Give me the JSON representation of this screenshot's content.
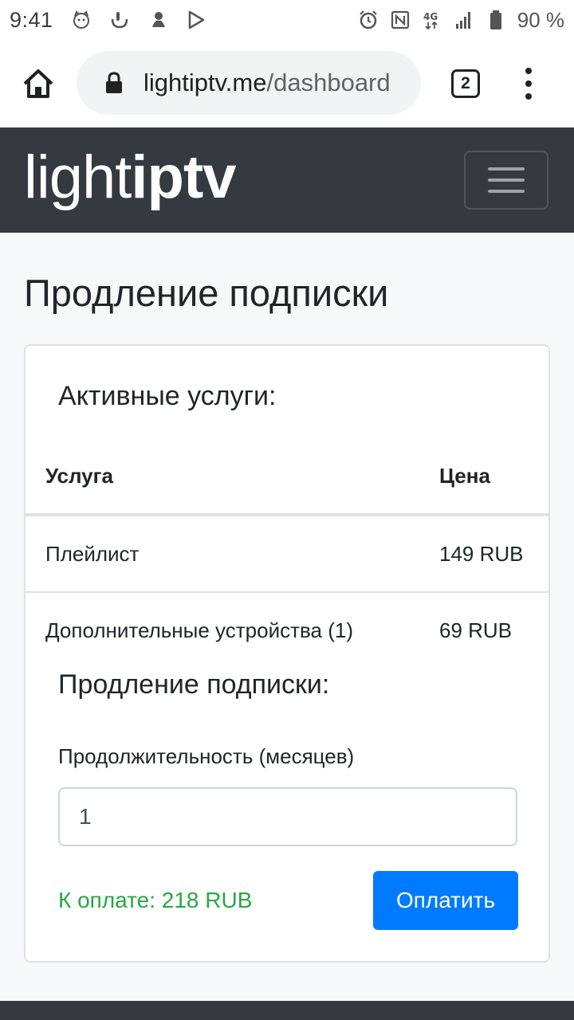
{
  "status_bar": {
    "time": "9:41",
    "battery_percent": "90 %",
    "left_icons": [
      "cat-notification-icon",
      "hand-notification-icon",
      "octopus-notification-icon",
      "play-store-icon"
    ],
    "right_icons": [
      "alarm-icon",
      "nfc-icon",
      "4g-signal-icon",
      "cell-signal-icon",
      "battery-icon"
    ]
  },
  "browser": {
    "url_host": "lightiptv.me",
    "url_path": "/dashboard",
    "tab_count": "2"
  },
  "navbar": {
    "logo_light": "light",
    "logo_bold": "iptv"
  },
  "page": {
    "title": "Продление подписки"
  },
  "card": {
    "active_services_title": "Активные услуги:",
    "table": {
      "headers": [
        "Услуга",
        "Цена"
      ],
      "rows": [
        [
          "Плейлист",
          "149 RUB"
        ],
        [
          "Дополнительные устройства (1)",
          "69 RUB"
        ]
      ]
    },
    "renewal_title": "Продление подписки:",
    "duration_label": "Продолжительность (месяцев)",
    "duration_value": "1",
    "total_text": "К оплате: 218 RUB",
    "pay_button": "Оплатить"
  },
  "colors": {
    "navbar_bg": "#343a40",
    "primary": "#007bff",
    "success": "#28a745",
    "page_bg": "#f7f8fa"
  }
}
